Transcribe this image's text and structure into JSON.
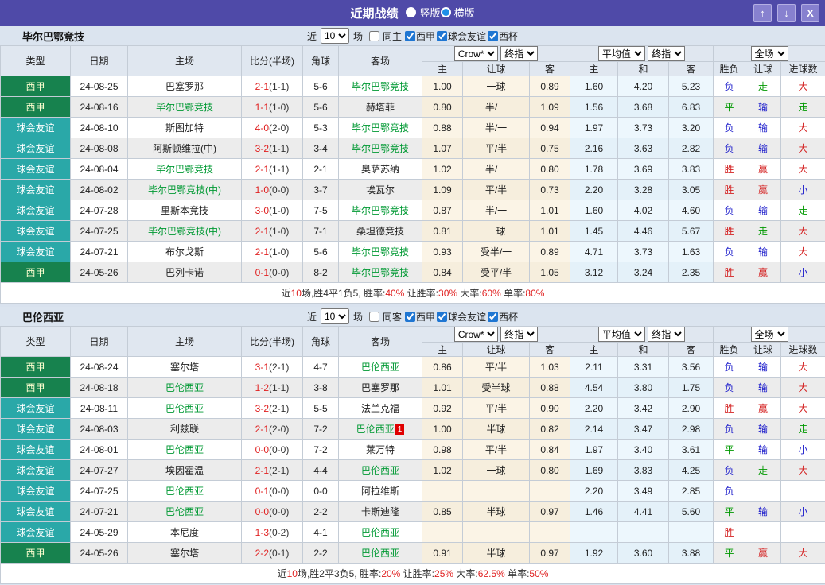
{
  "titlebar": {
    "title": "近期战绩",
    "radios": [
      {
        "label": "竖版",
        "selected": false
      },
      {
        "label": "横版",
        "selected": true
      }
    ],
    "buttons": {
      "up": "↑",
      "down": "↓",
      "close": "X"
    }
  },
  "table_header": {
    "main_cols": [
      "类型",
      "日期",
      "主场",
      "比分(半场)",
      "角球",
      "客场"
    ],
    "odds_selects": [
      "Crow*",
      "终指"
    ],
    "avg_selects": [
      "平均值",
      "终指"
    ],
    "result_select": "全场",
    "sub_cols": [
      "主",
      "让球",
      "客",
      "主",
      "和",
      "客",
      "胜负",
      "让球",
      "进球数"
    ]
  },
  "colors": {
    "titlebar_purple": "#4f4aa8",
    "button_purple": "#8781cf",
    "liga_badge_green": "#17824e",
    "friendly_badge_teal": "#2aa8a8",
    "focal_team_green": "#009933",
    "score_red": "#e02020",
    "result_red": "#d42222",
    "result_green": "#009900",
    "result_blue": "#2020cc",
    "header_bg": "#e0e7f0",
    "odds_cream": "#fbf4e6",
    "avg_blue": "#edf7fd"
  },
  "sections": [
    {
      "team": "毕尔巴鄂竞技",
      "filter": {
        "near": "近",
        "count": "10",
        "games": "场",
        "same": "同主",
        "same_checked": false,
        "leagues": [
          {
            "label": "西甲",
            "checked": true
          },
          {
            "label": "球会友谊",
            "checked": true
          },
          {
            "label": "西杯",
            "checked": true
          }
        ]
      },
      "rows": [
        {
          "type": "西甲",
          "date": "24-08-25",
          "home": "巴塞罗那",
          "home_focal": false,
          "score": "2-1",
          "half": "(1-1)",
          "corner": "5-6",
          "away": "毕尔巴鄂竞技",
          "away_focal": true,
          "oh": "1.00",
          "hc": "一球",
          "oa": "0.89",
          "ah": "1.60",
          "ad": "4.20",
          "aa": "5.23",
          "res": "负",
          "hres": "走",
          "gres": "大"
        },
        {
          "type": "西甲",
          "date": "24-08-16",
          "home": "毕尔巴鄂竞技",
          "home_focal": true,
          "score": "1-1",
          "half": "(1-0)",
          "corner": "5-6",
          "away": "赫塔菲",
          "away_focal": false,
          "oh": "0.80",
          "hc": "半/一",
          "oa": "1.09",
          "ah": "1.56",
          "ad": "3.68",
          "aa": "6.83",
          "res": "平",
          "hres": "输",
          "gres": "走"
        },
        {
          "type": "球会友谊",
          "date": "24-08-10",
          "home": "斯图加特",
          "home_focal": false,
          "score": "4-0",
          "half": "(2-0)",
          "corner": "5-3",
          "away": "毕尔巴鄂竞技",
          "away_focal": true,
          "oh": "0.88",
          "hc": "半/一",
          "oa": "0.94",
          "ah": "1.97",
          "ad": "3.73",
          "aa": "3.20",
          "res": "负",
          "hres": "输",
          "gres": "大"
        },
        {
          "type": "球会友谊",
          "date": "24-08-08",
          "home": "阿斯顿维拉(中)",
          "home_focal": false,
          "score": "3-2",
          "half": "(1-1)",
          "corner": "3-4",
          "away": "毕尔巴鄂竞技",
          "away_focal": true,
          "oh": "1.07",
          "hc": "平/半",
          "oa": "0.75",
          "ah": "2.16",
          "ad": "3.63",
          "aa": "2.82",
          "res": "负",
          "hres": "输",
          "gres": "大"
        },
        {
          "type": "球会友谊",
          "date": "24-08-04",
          "home": "毕尔巴鄂竞技",
          "home_focal": true,
          "score": "2-1",
          "half": "(1-1)",
          "corner": "2-1",
          "away": "奥萨苏纳",
          "away_focal": false,
          "oh": "1.02",
          "hc": "半/一",
          "oa": "0.80",
          "ah": "1.78",
          "ad": "3.69",
          "aa": "3.83",
          "res": "胜",
          "hres": "赢",
          "gres": "大"
        },
        {
          "type": "球会友谊",
          "date": "24-08-02",
          "home": "毕尔巴鄂竞技(中)",
          "home_focal": true,
          "score": "1-0",
          "half": "(0-0)",
          "corner": "3-7",
          "away": "埃瓦尔",
          "away_focal": false,
          "oh": "1.09",
          "hc": "平/半",
          "oa": "0.73",
          "ah": "2.20",
          "ad": "3.28",
          "aa": "3.05",
          "res": "胜",
          "hres": "赢",
          "gres": "小"
        },
        {
          "type": "球会友谊",
          "date": "24-07-28",
          "home": "里斯本竞技",
          "home_focal": false,
          "score": "3-0",
          "half": "(1-0)",
          "corner": "7-5",
          "away": "毕尔巴鄂竞技",
          "away_focal": true,
          "oh": "0.87",
          "hc": "半/一",
          "oa": "1.01",
          "ah": "1.60",
          "ad": "4.02",
          "aa": "4.60",
          "res": "负",
          "hres": "输",
          "gres": "走"
        },
        {
          "type": "球会友谊",
          "date": "24-07-25",
          "home": "毕尔巴鄂竞技(中)",
          "home_focal": true,
          "score": "2-1",
          "half": "(1-0)",
          "corner": "7-1",
          "away": "桑坦德竞技",
          "away_focal": false,
          "oh": "0.81",
          "hc": "一球",
          "oa": "1.01",
          "ah": "1.45",
          "ad": "4.46",
          "aa": "5.67",
          "res": "胜",
          "hres": "走",
          "gres": "大"
        },
        {
          "type": "球会友谊",
          "date": "24-07-21",
          "home": "布尔戈斯",
          "home_focal": false,
          "score": "2-1",
          "half": "(1-0)",
          "corner": "5-6",
          "away": "毕尔巴鄂竞技",
          "away_focal": true,
          "oh": "0.93",
          "hc": "受半/一",
          "oa": "0.89",
          "ah": "4.71",
          "ad": "3.73",
          "aa": "1.63",
          "res": "负",
          "hres": "输",
          "gres": "大"
        },
        {
          "type": "西甲",
          "date": "24-05-26",
          "home": "巴列卡诺",
          "home_focal": false,
          "score": "0-1",
          "half": "(0-0)",
          "corner": "8-2",
          "away": "毕尔巴鄂竞技",
          "away_focal": true,
          "oh": "0.84",
          "hc": "受平/半",
          "oa": "1.05",
          "ah": "3.12",
          "ad": "3.24",
          "aa": "2.35",
          "res": "胜",
          "hres": "赢",
          "gres": "小"
        }
      ],
      "summary": [
        {
          "text": "近",
          "red": false
        },
        {
          "text": "10",
          "red": true
        },
        {
          "text": "场,胜4平1负5, 胜率:",
          "red": false
        },
        {
          "text": "40%",
          "red": true
        },
        {
          "text": " 让胜率:",
          "red": false
        },
        {
          "text": "30%",
          "red": true
        },
        {
          "text": " 大率:",
          "red": false
        },
        {
          "text": "60%",
          "red": true
        },
        {
          "text": " 单率:",
          "red": false
        },
        {
          "text": "80%",
          "red": true
        }
      ]
    },
    {
      "team": "巴伦西亚",
      "filter": {
        "near": "近",
        "count": "10",
        "games": "场",
        "same": "同客",
        "same_checked": false,
        "leagues": [
          {
            "label": "西甲",
            "checked": true
          },
          {
            "label": "球会友谊",
            "checked": true
          },
          {
            "label": "西杯",
            "checked": true
          }
        ]
      },
      "rows": [
        {
          "type": "西甲",
          "date": "24-08-24",
          "home": "塞尔塔",
          "home_focal": false,
          "score": "3-1",
          "half": "(2-1)",
          "corner": "4-7",
          "away": "巴伦西亚",
          "away_focal": true,
          "oh": "0.86",
          "hc": "平/半",
          "oa": "1.03",
          "ah": "2.11",
          "ad": "3.31",
          "aa": "3.56",
          "res": "负",
          "hres": "输",
          "gres": "大"
        },
        {
          "type": "西甲",
          "date": "24-08-18",
          "home": "巴伦西亚",
          "home_focal": true,
          "score": "1-2",
          "half": "(1-1)",
          "corner": "3-8",
          "away": "巴塞罗那",
          "away_focal": false,
          "oh": "1.01",
          "hc": "受半球",
          "oa": "0.88",
          "ah": "4.54",
          "ad": "3.80",
          "aa": "1.75",
          "res": "负",
          "hres": "输",
          "gres": "大"
        },
        {
          "type": "球会友谊",
          "date": "24-08-11",
          "home": "巴伦西亚",
          "home_focal": true,
          "score": "3-2",
          "half": "(2-1)",
          "corner": "5-5",
          "away": "法兰克福",
          "away_focal": false,
          "oh": "0.92",
          "hc": "平/半",
          "oa": "0.90",
          "ah": "2.20",
          "ad": "3.42",
          "aa": "2.90",
          "res": "胜",
          "hres": "赢",
          "gres": "大"
        },
        {
          "type": "球会友谊",
          "date": "24-08-03",
          "home": "利兹联",
          "home_focal": false,
          "score": "2-1",
          "half": "(2-0)",
          "corner": "7-2",
          "away": "巴伦西亚",
          "away_focal": true,
          "away_red_card": "1",
          "oh": "1.00",
          "hc": "半球",
          "oa": "0.82",
          "ah": "2.14",
          "ad": "3.47",
          "aa": "2.98",
          "res": "负",
          "hres": "输",
          "gres": "走"
        },
        {
          "type": "球会友谊",
          "date": "24-08-01",
          "home": "巴伦西亚",
          "home_focal": true,
          "score": "0-0",
          "half": "(0-0)",
          "corner": "7-2",
          "away": "莱万特",
          "away_focal": false,
          "oh": "0.98",
          "hc": "平/半",
          "oa": "0.84",
          "ah": "1.97",
          "ad": "3.40",
          "aa": "3.61",
          "res": "平",
          "hres": "输",
          "gres": "小"
        },
        {
          "type": "球会友谊",
          "date": "24-07-27",
          "home": "埃因霍温",
          "home_focal": false,
          "score": "2-1",
          "half": "(2-1)",
          "corner": "4-4",
          "away": "巴伦西亚",
          "away_focal": true,
          "oh": "1.02",
          "hc": "一球",
          "oa": "0.80",
          "ah": "1.69",
          "ad": "3.83",
          "aa": "4.25",
          "res": "负",
          "hres": "走",
          "gres": "大"
        },
        {
          "type": "球会友谊",
          "date": "24-07-25",
          "home": "巴伦西亚",
          "home_focal": true,
          "score": "0-1",
          "half": "(0-0)",
          "corner": "0-0",
          "away": "阿拉维斯",
          "away_focal": false,
          "oh": "",
          "hc": "",
          "oa": "",
          "ah": "2.20",
          "ad": "3.49",
          "aa": "2.85",
          "res": "负",
          "hres": "",
          "gres": ""
        },
        {
          "type": "球会友谊",
          "date": "24-07-21",
          "home": "巴伦西亚",
          "home_focal": true,
          "score": "0-0",
          "half": "(0-0)",
          "corner": "2-2",
          "away": "卡斯迪隆",
          "away_focal": false,
          "oh": "0.85",
          "hc": "半球",
          "oa": "0.97",
          "ah": "1.46",
          "ad": "4.41",
          "aa": "5.60",
          "res": "平",
          "hres": "输",
          "gres": "小"
        },
        {
          "type": "球会友谊",
          "date": "24-05-29",
          "home": "本尼度",
          "home_focal": false,
          "score": "1-3",
          "half": "(0-2)",
          "corner": "4-1",
          "away": "巴伦西亚",
          "away_focal": true,
          "oh": "",
          "hc": "",
          "oa": "",
          "ah": "",
          "ad": "",
          "aa": "",
          "res": "胜",
          "hres": "",
          "gres": ""
        },
        {
          "type": "西甲",
          "date": "24-05-26",
          "home": "塞尔塔",
          "home_focal": false,
          "score": "2-2",
          "half": "(0-1)",
          "corner": "2-2",
          "away": "巴伦西亚",
          "away_focal": true,
          "oh": "0.91",
          "hc": "半球",
          "oa": "0.97",
          "ah": "1.92",
          "ad": "3.60",
          "aa": "3.88",
          "res": "平",
          "hres": "赢",
          "gres": "大"
        }
      ],
      "summary": [
        {
          "text": "近",
          "red": false
        },
        {
          "text": "10",
          "red": true
        },
        {
          "text": "场,胜2平3负5, 胜率:",
          "red": false
        },
        {
          "text": "20%",
          "red": true
        },
        {
          "text": " 让胜率:",
          "red": false
        },
        {
          "text": "25%",
          "red": true
        },
        {
          "text": " 大率:",
          "red": false
        },
        {
          "text": "62.5%",
          "red": true
        },
        {
          "text": " 单率:",
          "red": false
        },
        {
          "text": "50%",
          "red": true
        }
      ]
    }
  ]
}
